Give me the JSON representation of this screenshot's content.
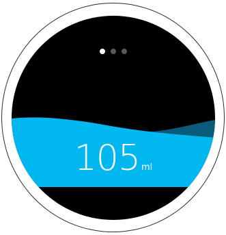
{
  "app": {
    "pager": {
      "count": 3,
      "active_index": 0
    },
    "intake": {
      "value": "105",
      "unit": "ml"
    },
    "colors": {
      "background": "#000000",
      "water": "#00b7f0",
      "water_back_wave": "#0a5a7a",
      "text": "#ffffff",
      "dot_active": "#ffffff",
      "dot_inactive": "#5a5a5a"
    }
  }
}
